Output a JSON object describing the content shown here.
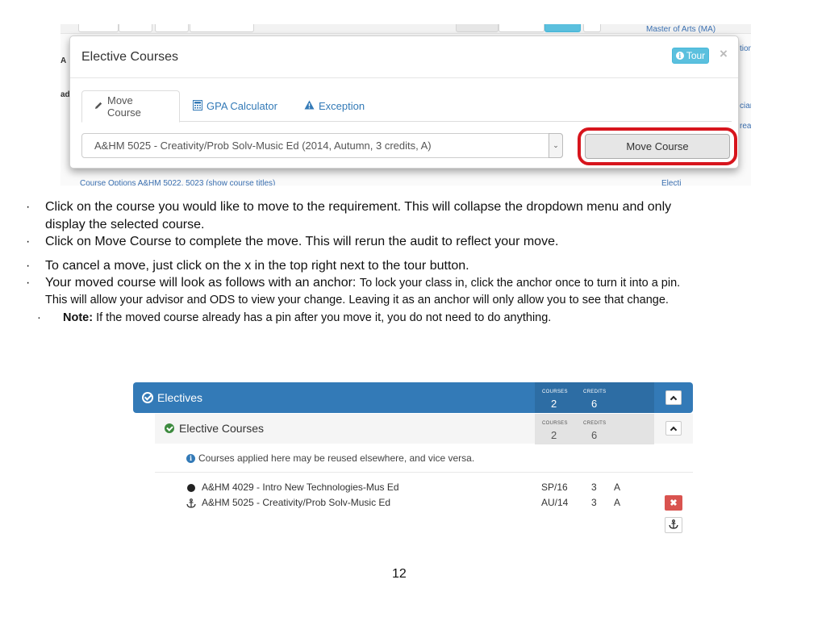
{
  "screenshot_modal": {
    "background": {
      "top_link": "Master of Arts (MA)",
      "left_fragments": [
        "A",
        "ad"
      ],
      "right_fragments": [
        "tion",
        "ciar",
        "rea"
      ],
      "bottom_link": "Course Options A&HM 5022, 5023 (show course titles)",
      "bottom_right_link": "Electi"
    },
    "modal": {
      "title": "Elective Courses",
      "tour_button": "Tour",
      "close_glyph": "×",
      "tabs": [
        {
          "label": "Move Course",
          "icon": "pencil-icon",
          "active": true
        },
        {
          "label": "GPA Calculator",
          "icon": "calculator-icon",
          "active": false
        },
        {
          "label": "Exception",
          "icon": "warning-icon",
          "active": false
        }
      ],
      "course_select": {
        "selected": "A&HM 5025 - Creativity/Prob Solv-Music Ed (2014, Autumn, 3 credits, A)"
      },
      "move_button": "Move Course",
      "highlight_color": "#d7151d"
    }
  },
  "instructions": [
    {
      "bullet": "·",
      "lines": [
        "Click on the course you would like to move to the requirement. This will collapse the dropdown menu and only",
        "display the selected course."
      ]
    },
    {
      "bullet": "·",
      "lines": [
        "Click on Move Course to complete the move. This will rerun the audit to reflect your move."
      ]
    },
    {
      "bullet": "·",
      "lines": [
        "To cancel a move, just click on the x in the top right next to the tour button."
      ]
    },
    {
      "bullet": "·",
      "lead": "Your moved course will look as follows with an anchor: ",
      "rest": "To lock your class in, click the anchor once to turn it into a pin.",
      "line2": "This will  allow your advisor and ODS to view your change. Leaving it as an anchor will only allow you to see that change."
    },
    {
      "bullet": "·",
      "bold": "Note:",
      "text": " If the moved course already has a pin after you move it, you do not need to do anything."
    }
  ],
  "screenshot_electives": {
    "header": {
      "title": "Electives",
      "courses_label": "COURSES",
      "courses_value": "2",
      "credits_label": "CREDITS",
      "credits_value": "6",
      "color": "#337ab7"
    },
    "subheader": {
      "title": "Elective Courses",
      "courses_label": "COURSES",
      "courses_value": "2",
      "credits_label": "CREDITS",
      "credits_value": "6"
    },
    "note": "Courses applied here may be reused elsewhere, and vice versa.",
    "courses": [
      {
        "icon": "dot-icon",
        "name": "A&HM 4029 - Intro New Technologies-Mus Ed",
        "term": "SP/16",
        "credits": "3",
        "grade": "A"
      },
      {
        "icon": "anchor-icon",
        "name": "A&HM 5025 - Creativity/Prob Solv-Music Ed",
        "term": "AU/14",
        "credits": "3",
        "grade": "A"
      }
    ],
    "delete_glyph": "✖",
    "anchor_glyph": "⚓"
  },
  "page_number": "12"
}
